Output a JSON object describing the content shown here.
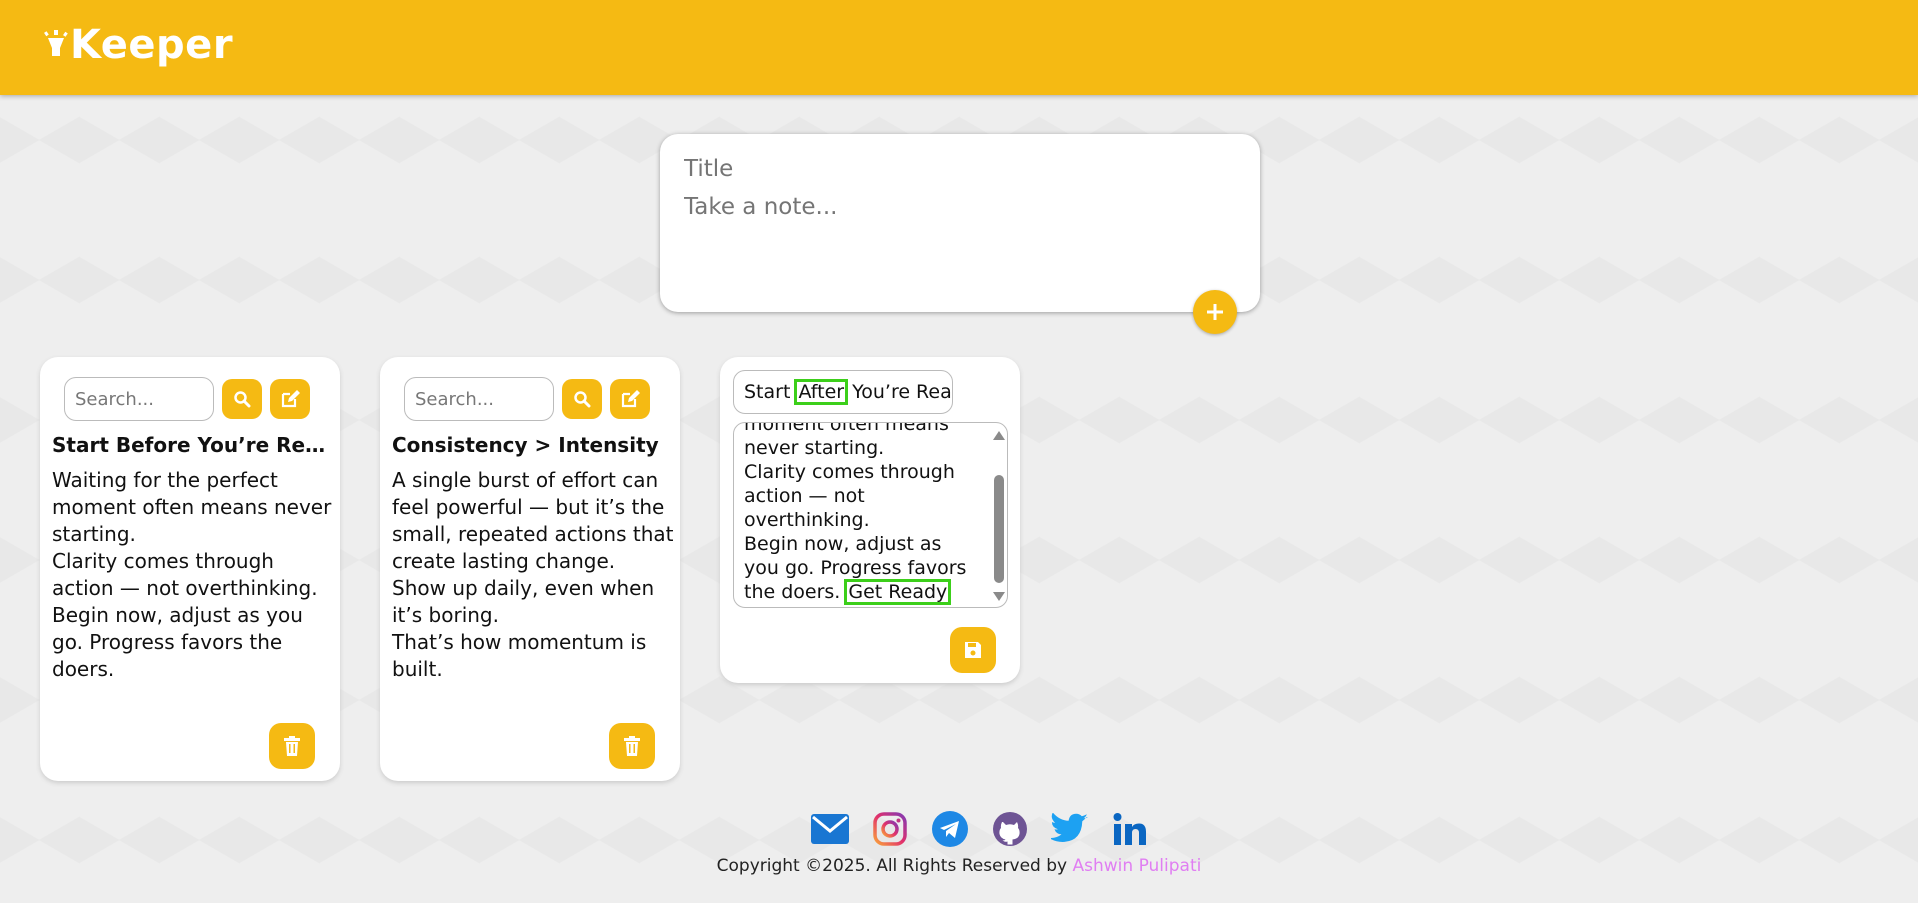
{
  "header": {
    "app_name": "Keeper"
  },
  "create_note": {
    "title_placeholder": "Title",
    "content_placeholder": "Take a note..."
  },
  "notes": [
    {
      "search_placeholder": "Search...",
      "title": "Start Before You’re Rea...",
      "body": [
        "Waiting for the perfect moment often means never starting.",
        "Clarity comes through action — not overthinking.",
        "Begin now, adjust as you go. Progress favors the doers."
      ]
    },
    {
      "search_placeholder": "Search...",
      "title": "Consistency > Intensity",
      "body": [
        "A single burst of effort can feel powerful — but it’s the small, repeated actions that create lasting change.",
        "Show up daily, even when it’s boring.",
        "That’s how momentum is built."
      ]
    }
  ],
  "editing_note": {
    "title_before": "Start ",
    "title_highlight": "After",
    "title_after": " You’re Reac",
    "body_lines": [
      "moment often means",
      "never starting.",
      "Clarity comes through",
      "action — not",
      "overthinking.",
      "Begin now, adjust as",
      "you go. Progress favors"
    ],
    "body_last_prefix": "the doers. ",
    "body_highlight": "Get Ready"
  },
  "footer": {
    "copyright": "Copyright ©2025. All Rights Reserved by ",
    "author": "Ashwin Pulipati",
    "socials": [
      "mail-icon",
      "instagram-icon",
      "telegram-icon",
      "github-icon",
      "twitter-icon",
      "linkedin-icon"
    ]
  },
  "colors": {
    "accent": "#f5ba13",
    "highlight": "#3ccf1a",
    "author": "#e07ef2"
  }
}
